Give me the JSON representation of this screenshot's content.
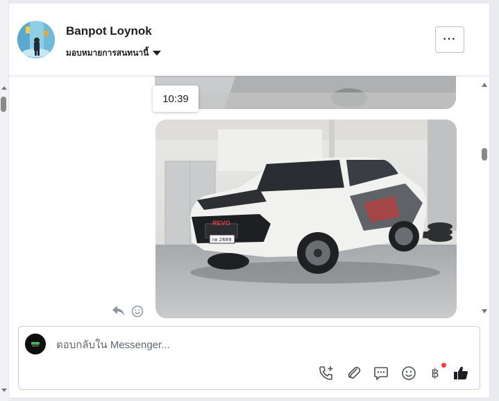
{
  "header": {
    "contact_name": "Banpot Loynok",
    "assign_label": "มอบหมายการสนทนานี้",
    "more_label": "···"
  },
  "thread": {
    "timestamp": "10:39",
    "plate_text": "กธ 2689",
    "brand_text": "REVO"
  },
  "composer": {
    "placeholder": "ตอบกลับใน Messenger...",
    "tools": [
      "call-add-icon",
      "paperclip-icon",
      "saved-reply-icon",
      "emoji-icon",
      "baht-payment-icon",
      "thumbs-up-icon"
    ],
    "baht_symbol": "฿",
    "notification_color": "#fa383e"
  },
  "colors": {
    "icon": "#4b4f56",
    "border": "#ccd0d5"
  }
}
